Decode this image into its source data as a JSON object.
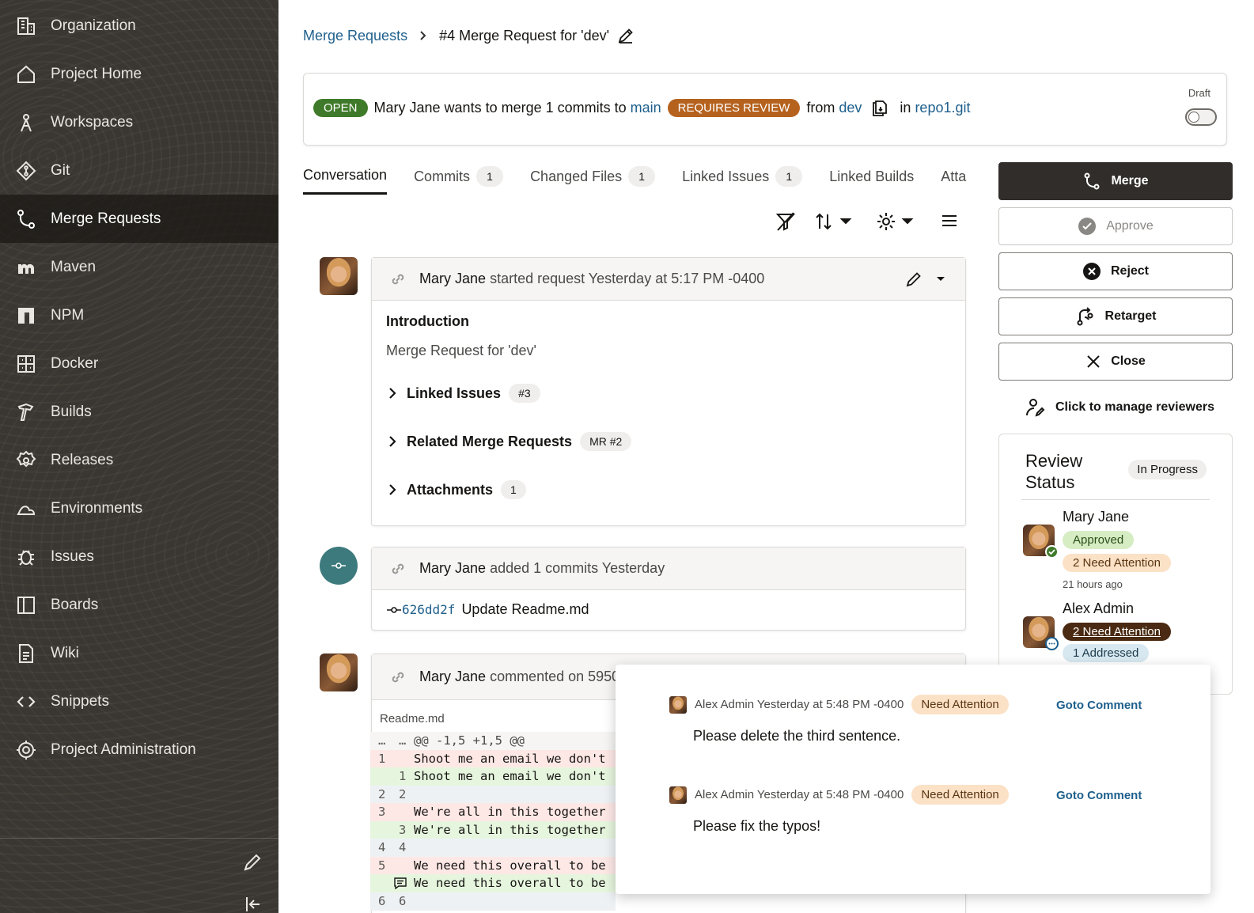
{
  "sidebar": {
    "items": [
      {
        "label": "Organization",
        "icon": "building-icon"
      },
      {
        "label": "Project Home",
        "icon": "home-icon"
      },
      {
        "label": "Workspaces",
        "icon": "compass-icon"
      },
      {
        "label": "Git",
        "icon": "git-icon"
      },
      {
        "label": "Merge Requests",
        "icon": "merge-request-icon",
        "active": true
      },
      {
        "label": "Maven",
        "icon": "maven-icon"
      },
      {
        "label": "NPM",
        "icon": "npm-icon"
      },
      {
        "label": "Docker",
        "icon": "docker-icon"
      },
      {
        "label": "Builds",
        "icon": "hammer-icon"
      },
      {
        "label": "Releases",
        "icon": "gear-badge-icon"
      },
      {
        "label": "Environments",
        "icon": "cloud-icon"
      },
      {
        "label": "Issues",
        "icon": "bug-icon"
      },
      {
        "label": "Boards",
        "icon": "board-icon"
      },
      {
        "label": "Wiki",
        "icon": "document-icon"
      },
      {
        "label": "Snippets",
        "icon": "code-icon"
      },
      {
        "label": "Project Administration",
        "icon": "settings-icon"
      }
    ]
  },
  "breadcrumb": {
    "parent": "Merge Requests",
    "current": "#4 Merge Request for 'dev'"
  },
  "banner": {
    "status": "OPEN",
    "text1": "Mary Jane wants to merge 1 commits to",
    "target_branch": "main",
    "review_badge": "REQUIRES REVIEW",
    "from_label": "from",
    "source_branch": "dev",
    "in_label": "in",
    "repo": "repo1.git",
    "draft_label": "Draft"
  },
  "tabs": [
    {
      "label": "Conversation",
      "count": null,
      "active": true
    },
    {
      "label": "Commits",
      "count": "1"
    },
    {
      "label": "Changed Files",
      "count": "1"
    },
    {
      "label": "Linked Issues",
      "count": "1"
    },
    {
      "label": "Linked Builds",
      "count": null
    },
    {
      "label": "Atta",
      "count": null
    }
  ],
  "request_card": {
    "author": "Mary Jane",
    "action": "started request Yesterday at 5:17 PM -0400",
    "intro_title": "Introduction",
    "intro_text": "Merge Request for 'dev'",
    "sections": [
      {
        "label": "Linked Issues",
        "pill": "#3"
      },
      {
        "label": "Related Merge Requests",
        "pill": "MR #2"
      },
      {
        "label": "Attachments",
        "pill": "1"
      }
    ]
  },
  "commit_card": {
    "author": "Mary Jane",
    "action": "added 1 commits Yesterday",
    "hash": "626dd2f",
    "message": "Update Readme.md"
  },
  "comment_card": {
    "author": "Mary Jane",
    "action": "commented on 5950",
    "file": "Readme.md"
  },
  "diff": {
    "lines": [
      {
        "n1": "…",
        "n2": "…",
        "code": "@@ -1,5 +1,5 @@",
        "kind": "hunk"
      },
      {
        "n1": "1",
        "n2": "",
        "code": "Shoot me an email we don't",
        "kind": "del"
      },
      {
        "n1": "",
        "n2": "1",
        "code": "Shoot me an email we don't",
        "kind": "add"
      },
      {
        "n1": "2",
        "n2": "2",
        "code": "",
        "kind": "ctx"
      },
      {
        "n1": "3",
        "n2": "",
        "code": "We're all in this together",
        "kind": "del"
      },
      {
        "n1": "",
        "n2": "3",
        "code": "We're all in this together",
        "kind": "add"
      },
      {
        "n1": "4",
        "n2": "4",
        "code": "",
        "kind": "ctx"
      },
      {
        "n1": "5",
        "n2": "",
        "code": "We need this overall to be",
        "kind": "del"
      },
      {
        "n1": "",
        "n2": "",
        "code": "We need this overall to be",
        "kind": "add-comment"
      },
      {
        "n1": "6",
        "n2": "6",
        "code": "",
        "kind": "ctx"
      }
    ]
  },
  "actions": {
    "merge": "Merge",
    "approve": "Approve",
    "reject": "Reject",
    "retarget": "Retarget",
    "close": "Close",
    "reviewers": "Click to manage reviewers"
  },
  "review": {
    "title_line1": "Review",
    "title_line2": "Status",
    "status": "In Progress",
    "reviewers": [
      {
        "name": "Mary Jane",
        "badge1": "Approved",
        "badge2": "2 Need Attention",
        "time": "21 hours ago"
      },
      {
        "name": "Alex Admin",
        "badge1": "2 Need Attention",
        "badge2": "1 Addressed"
      }
    ]
  },
  "popup": {
    "comments": [
      {
        "meta": "Alex Admin Yesterday at 5:48 PM -0400",
        "badge": "Need Attention",
        "link": "Goto Comment",
        "text": "Please delete the third sentence."
      },
      {
        "meta": "Alex Admin Yesterday at 5:48 PM -0400",
        "badge": "Need Attention",
        "link": "Goto Comment",
        "text": "Please fix the typos!"
      }
    ]
  },
  "colors": {
    "sidebar_bg": "#3a3631",
    "link": "#1e5f8c",
    "open_badge": "#3f7a2a",
    "review_badge": "#b5621e",
    "primary_button": "#312d2a"
  }
}
